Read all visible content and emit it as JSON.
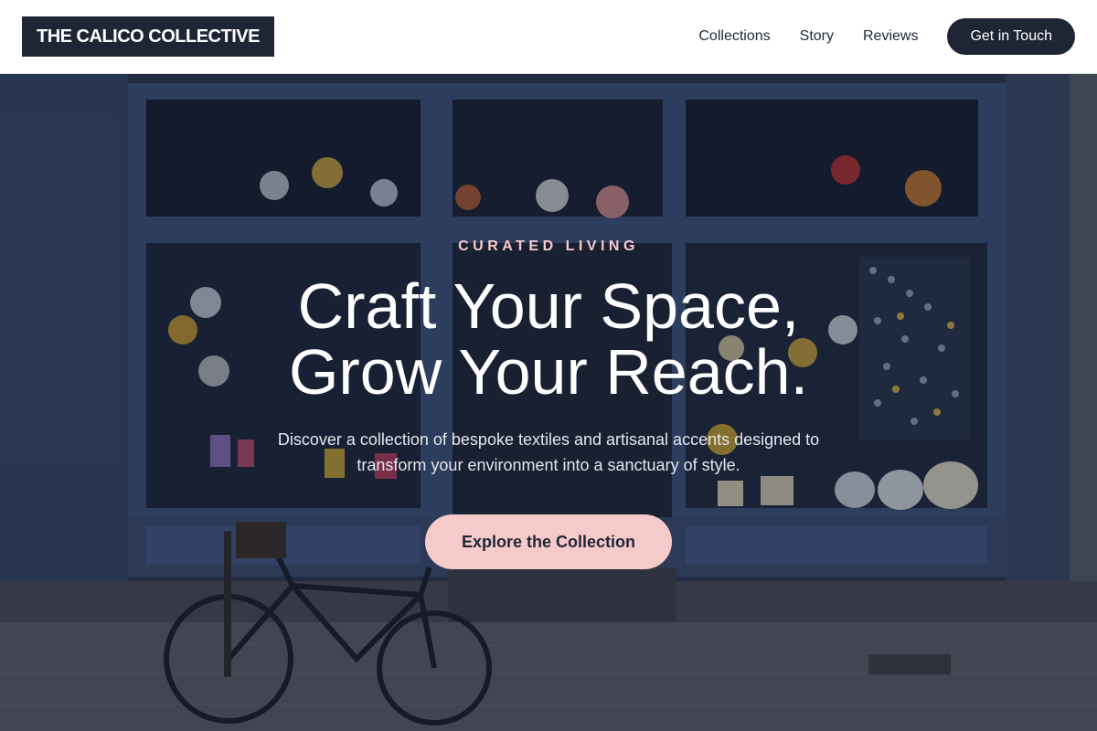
{
  "header": {
    "logo": "THE CALICO COLLECTIVE",
    "nav": [
      {
        "label": "Collections"
      },
      {
        "label": "Story"
      },
      {
        "label": "Reviews"
      }
    ],
    "cta_label": "Get in Touch"
  },
  "hero": {
    "eyebrow": "CURATED LIVING",
    "headline_line1": "Craft Your Space,",
    "headline_line2": "Grow Your Reach.",
    "description_line1": "Discover a collection of bespoke textiles and artisanal accents designed to",
    "description_line2": "transform your environment into a sanctuary of style.",
    "cta_label": "Explore the Collection",
    "background_image": "storefront-with-bicycle"
  },
  "colors": {
    "brand_dark": "#1e2636",
    "accent_pink": "#f6c9cb",
    "header_bg": "#ffffff"
  }
}
